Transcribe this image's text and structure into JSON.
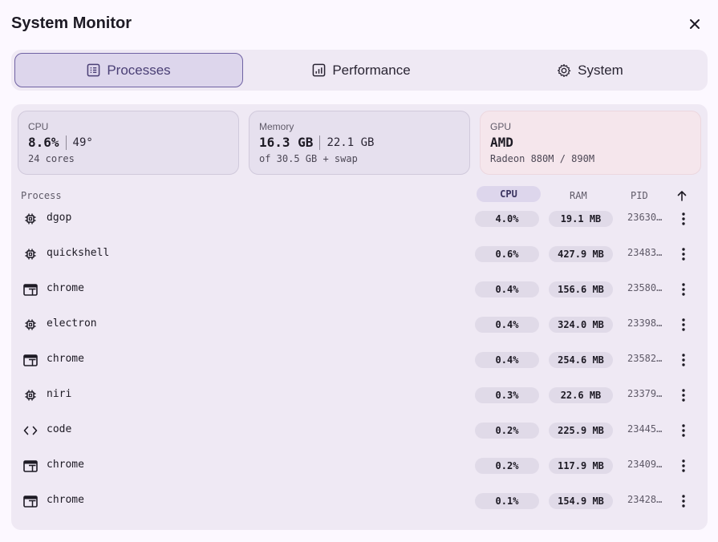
{
  "window": {
    "title": "System Monitor"
  },
  "tabs": [
    {
      "label": "Processes",
      "icon": "list-icon",
      "active": true
    },
    {
      "label": "Performance",
      "icon": "chart-icon",
      "active": false
    },
    {
      "label": "System",
      "icon": "gear-icon",
      "active": false
    }
  ],
  "cards": {
    "cpu": {
      "label": "CPU",
      "value": "8.6%",
      "secondary": "49°",
      "sub": "24 cores"
    },
    "memory": {
      "label": "Memory",
      "value": "16.3 GB",
      "secondary": "22.1 GB",
      "sub": "of 30.5 GB + swap"
    },
    "gpu": {
      "label": "GPU",
      "value": "AMD",
      "sub": "Radeon 880M / 890M",
      "accent": "#f5e6ec"
    }
  },
  "table": {
    "headers": {
      "process": "Process",
      "cpu": "CPU",
      "ram": "RAM",
      "pid": "PID",
      "sort_icon": "arrow-up-icon"
    },
    "rows": [
      {
        "icon": "chip-icon",
        "name": "dgop",
        "cpu": "4.0%",
        "ram": "19.1 MB",
        "pid": "23630…"
      },
      {
        "icon": "chip-icon",
        "name": "quickshell",
        "cpu": "0.6%",
        "ram": "427.9 MB",
        "pid": "23483…"
      },
      {
        "icon": "window-icon",
        "name": "chrome",
        "cpu": "0.4%",
        "ram": "156.6 MB",
        "pid": "23580…"
      },
      {
        "icon": "chip-icon",
        "name": "electron",
        "cpu": "0.4%",
        "ram": "324.0 MB",
        "pid": "23398…"
      },
      {
        "icon": "window-icon",
        "name": "chrome",
        "cpu": "0.4%",
        "ram": "254.6 MB",
        "pid": "23582…"
      },
      {
        "icon": "chip-icon",
        "name": "niri",
        "cpu": "0.3%",
        "ram": "22.6 MB",
        "pid": "23379…"
      },
      {
        "icon": "code-icon",
        "name": "code",
        "cpu": "0.2%",
        "ram": "225.9 MB",
        "pid": "23445…"
      },
      {
        "icon": "window-icon",
        "name": "chrome",
        "cpu": "0.2%",
        "ram": "117.9 MB",
        "pid": "23409…"
      },
      {
        "icon": "window-icon",
        "name": "chrome",
        "cpu": "0.1%",
        "ram": "154.9 MB",
        "pid": "23428…"
      }
    ]
  },
  "colors": {
    "accent": "#6f62a3",
    "background": "#fcf8ff",
    "surface": "#efe9f4"
  }
}
